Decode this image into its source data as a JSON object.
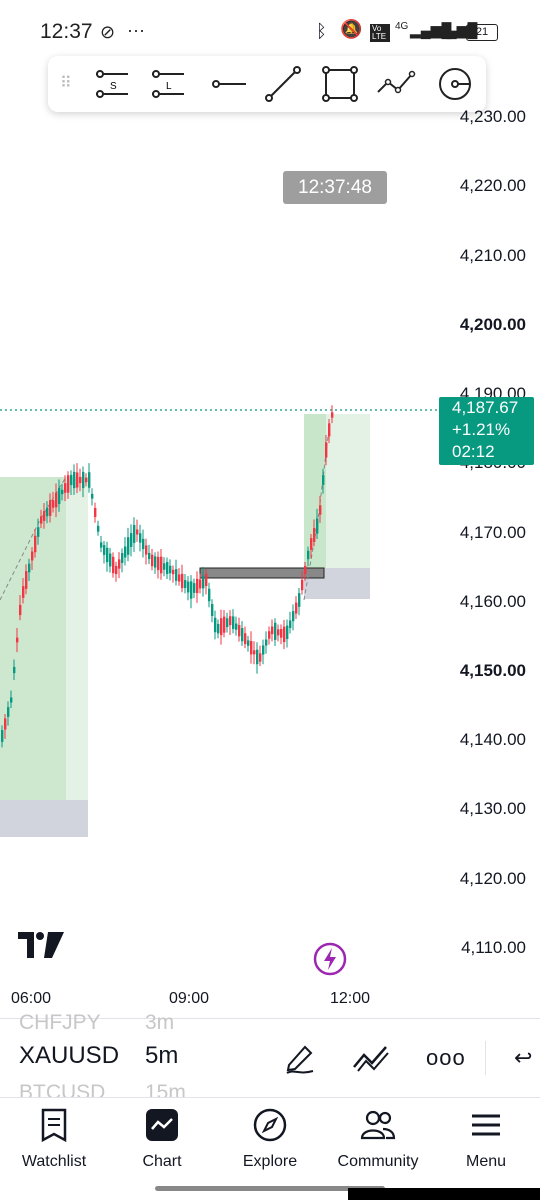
{
  "status_bar": {
    "time": "12:37",
    "network": "4G",
    "volte": "Vo LTE",
    "battery": "21"
  },
  "drawing_tools": [
    "s-line-icon",
    "l-line-icon",
    "horizontal-line-icon",
    "trend-line-icon",
    "rectangle-icon",
    "path-icon",
    "circle-tool-icon"
  ],
  "chart": {
    "clock": "12:37:48",
    "price_axis": [
      "4,230.00",
      "4,220.00",
      "4,210.00",
      "4,200.00",
      "4,190.00",
      "4,180.00",
      "4,170.00",
      "4,160.00",
      "4,150.00",
      "4,140.00",
      "4,130.00",
      "4,120.00",
      "4,110.00"
    ],
    "current_price": {
      "price": "4,187.67",
      "change": "+1.21%",
      "countdown": "02:12"
    },
    "time_axis": [
      "06:00",
      "09:00",
      "12:00"
    ],
    "colors": {
      "up": "#089981",
      "down": "#f23645",
      "candle_up_shown": "#089981"
    }
  },
  "symbol_bar": {
    "prev_symbol": "CHFJPY",
    "prev_interval": "3m",
    "symbol": "XAUUSD",
    "interval": "5m",
    "next_symbol": "BTCUSD",
    "next_interval": "15m"
  },
  "nav": {
    "items": [
      {
        "label": "Watchlist",
        "icon": "watchlist-icon"
      },
      {
        "label": "Chart",
        "icon": "chart-icon"
      },
      {
        "label": "Explore",
        "icon": "compass-icon"
      },
      {
        "label": "Community",
        "icon": "community-icon"
      },
      {
        "label": "Menu",
        "icon": "menu-icon"
      }
    ]
  }
}
